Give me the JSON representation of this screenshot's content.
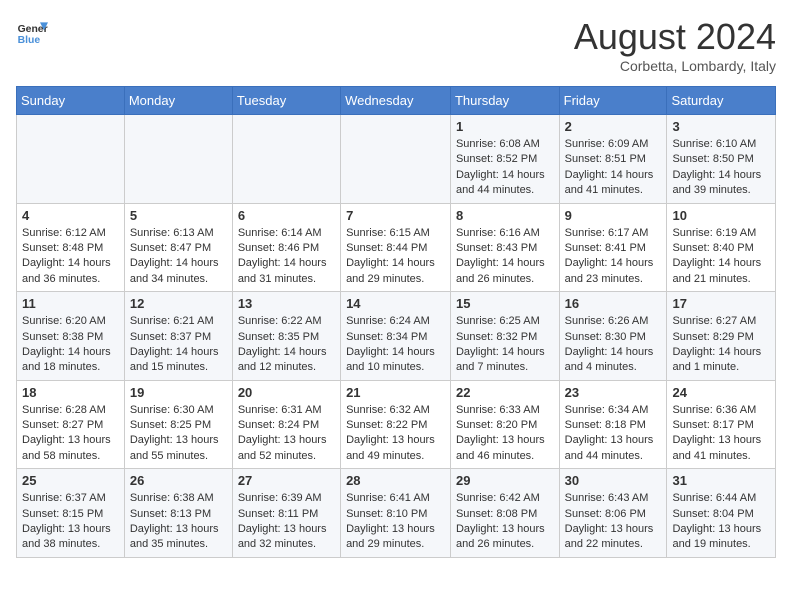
{
  "header": {
    "logo_line1": "General",
    "logo_line2": "Blue",
    "month": "August 2024",
    "location": "Corbetta, Lombardy, Italy"
  },
  "days_of_week": [
    "Sunday",
    "Monday",
    "Tuesday",
    "Wednesday",
    "Thursday",
    "Friday",
    "Saturday"
  ],
  "weeks": [
    {
      "days": [
        {
          "num": "",
          "info": ""
        },
        {
          "num": "",
          "info": ""
        },
        {
          "num": "",
          "info": ""
        },
        {
          "num": "",
          "info": ""
        },
        {
          "num": "1",
          "info": "Sunrise: 6:08 AM\nSunset: 8:52 PM\nDaylight: 14 hours and 44 minutes."
        },
        {
          "num": "2",
          "info": "Sunrise: 6:09 AM\nSunset: 8:51 PM\nDaylight: 14 hours and 41 minutes."
        },
        {
          "num": "3",
          "info": "Sunrise: 6:10 AM\nSunset: 8:50 PM\nDaylight: 14 hours and 39 minutes."
        }
      ]
    },
    {
      "days": [
        {
          "num": "4",
          "info": "Sunrise: 6:12 AM\nSunset: 8:48 PM\nDaylight: 14 hours and 36 minutes."
        },
        {
          "num": "5",
          "info": "Sunrise: 6:13 AM\nSunset: 8:47 PM\nDaylight: 14 hours and 34 minutes."
        },
        {
          "num": "6",
          "info": "Sunrise: 6:14 AM\nSunset: 8:46 PM\nDaylight: 14 hours and 31 minutes."
        },
        {
          "num": "7",
          "info": "Sunrise: 6:15 AM\nSunset: 8:44 PM\nDaylight: 14 hours and 29 minutes."
        },
        {
          "num": "8",
          "info": "Sunrise: 6:16 AM\nSunset: 8:43 PM\nDaylight: 14 hours and 26 minutes."
        },
        {
          "num": "9",
          "info": "Sunrise: 6:17 AM\nSunset: 8:41 PM\nDaylight: 14 hours and 23 minutes."
        },
        {
          "num": "10",
          "info": "Sunrise: 6:19 AM\nSunset: 8:40 PM\nDaylight: 14 hours and 21 minutes."
        }
      ]
    },
    {
      "days": [
        {
          "num": "11",
          "info": "Sunrise: 6:20 AM\nSunset: 8:38 PM\nDaylight: 14 hours and 18 minutes."
        },
        {
          "num": "12",
          "info": "Sunrise: 6:21 AM\nSunset: 8:37 PM\nDaylight: 14 hours and 15 minutes."
        },
        {
          "num": "13",
          "info": "Sunrise: 6:22 AM\nSunset: 8:35 PM\nDaylight: 14 hours and 12 minutes."
        },
        {
          "num": "14",
          "info": "Sunrise: 6:24 AM\nSunset: 8:34 PM\nDaylight: 14 hours and 10 minutes."
        },
        {
          "num": "15",
          "info": "Sunrise: 6:25 AM\nSunset: 8:32 PM\nDaylight: 14 hours and 7 minutes."
        },
        {
          "num": "16",
          "info": "Sunrise: 6:26 AM\nSunset: 8:30 PM\nDaylight: 14 hours and 4 minutes."
        },
        {
          "num": "17",
          "info": "Sunrise: 6:27 AM\nSunset: 8:29 PM\nDaylight: 14 hours and 1 minute."
        }
      ]
    },
    {
      "days": [
        {
          "num": "18",
          "info": "Sunrise: 6:28 AM\nSunset: 8:27 PM\nDaylight: 13 hours and 58 minutes."
        },
        {
          "num": "19",
          "info": "Sunrise: 6:30 AM\nSunset: 8:25 PM\nDaylight: 13 hours and 55 minutes."
        },
        {
          "num": "20",
          "info": "Sunrise: 6:31 AM\nSunset: 8:24 PM\nDaylight: 13 hours and 52 minutes."
        },
        {
          "num": "21",
          "info": "Sunrise: 6:32 AM\nSunset: 8:22 PM\nDaylight: 13 hours and 49 minutes."
        },
        {
          "num": "22",
          "info": "Sunrise: 6:33 AM\nSunset: 8:20 PM\nDaylight: 13 hours and 46 minutes."
        },
        {
          "num": "23",
          "info": "Sunrise: 6:34 AM\nSunset: 8:18 PM\nDaylight: 13 hours and 44 minutes."
        },
        {
          "num": "24",
          "info": "Sunrise: 6:36 AM\nSunset: 8:17 PM\nDaylight: 13 hours and 41 minutes."
        }
      ]
    },
    {
      "days": [
        {
          "num": "25",
          "info": "Sunrise: 6:37 AM\nSunset: 8:15 PM\nDaylight: 13 hours and 38 minutes."
        },
        {
          "num": "26",
          "info": "Sunrise: 6:38 AM\nSunset: 8:13 PM\nDaylight: 13 hours and 35 minutes."
        },
        {
          "num": "27",
          "info": "Sunrise: 6:39 AM\nSunset: 8:11 PM\nDaylight: 13 hours and 32 minutes."
        },
        {
          "num": "28",
          "info": "Sunrise: 6:41 AM\nSunset: 8:10 PM\nDaylight: 13 hours and 29 minutes."
        },
        {
          "num": "29",
          "info": "Sunrise: 6:42 AM\nSunset: 8:08 PM\nDaylight: 13 hours and 26 minutes."
        },
        {
          "num": "30",
          "info": "Sunrise: 6:43 AM\nSunset: 8:06 PM\nDaylight: 13 hours and 22 minutes."
        },
        {
          "num": "31",
          "info": "Sunrise: 6:44 AM\nSunset: 8:04 PM\nDaylight: 13 hours and 19 minutes."
        }
      ]
    }
  ]
}
